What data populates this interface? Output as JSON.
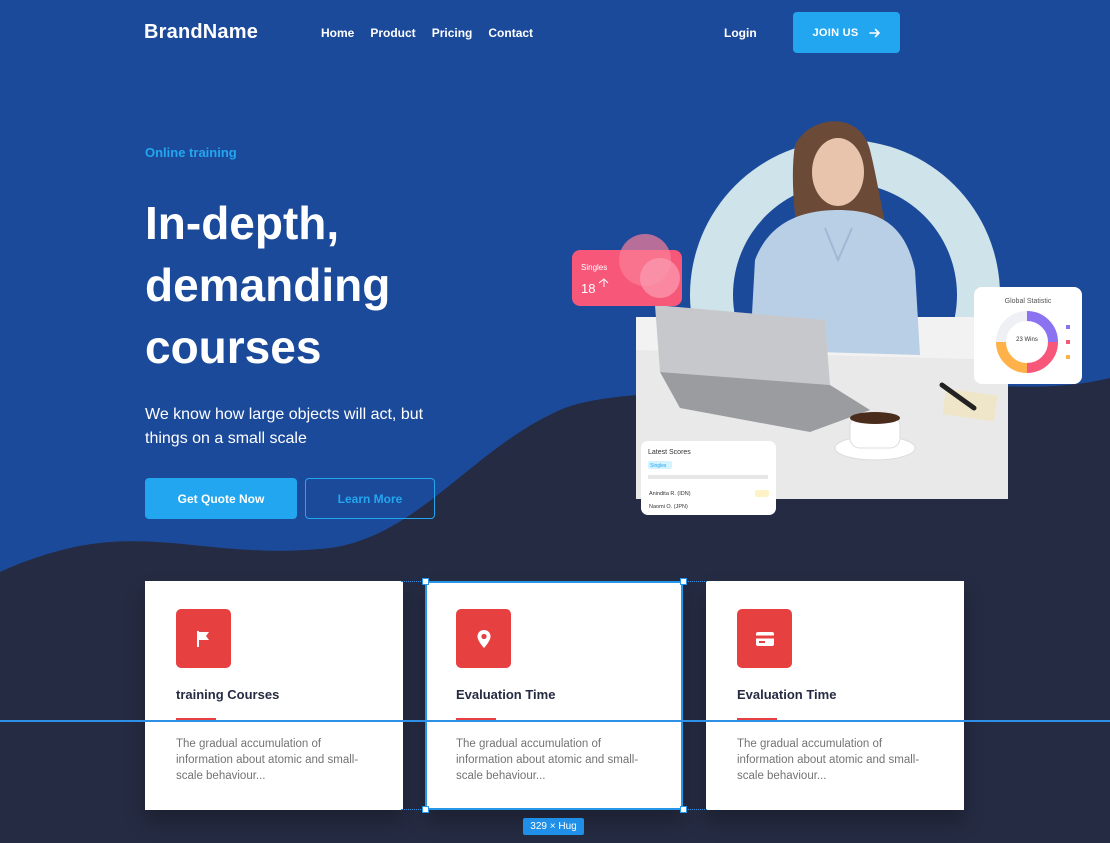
{
  "nav": {
    "brand": "BrandName",
    "links": [
      "Home",
      "Product",
      "Pricing",
      "Contact"
    ],
    "login": "Login",
    "join": "JOIN US"
  },
  "hero": {
    "eyebrow": "Online training",
    "headline": "In-depth, demanding courses",
    "subtitle": "We know how large objects will act, but things on a small scale",
    "primary_cta": "Get Quote Now",
    "secondary_cta": "Learn More"
  },
  "widgets": {
    "singles_label": "Singles",
    "singles_value": "18",
    "stat_title": "Global Statistic",
    "stat_center": "23 Wins",
    "scores_title": "Latest Scores",
    "scores_tag": "Singles",
    "row1": "Anindita R. (IDN)",
    "row2": "Naomi O. (JPN)"
  },
  "cards": [
    {
      "title": "training Courses",
      "desc": "The gradual accumulation of information about atomic and small-scale behaviour...",
      "icon": "flag-icon"
    },
    {
      "title": "Evaluation Time",
      "desc": "The gradual accumulation of information about atomic and small-scale behaviour...",
      "icon": "location-pin-icon"
    },
    {
      "title": "Evaluation Time",
      "desc": "The gradual accumulation of information about atomic and small-scale behaviour...",
      "icon": "credit-card-icon"
    }
  ],
  "design_tool": {
    "size_tag": "329 × Hug"
  },
  "colors": {
    "primary": "#23a6f0",
    "hero_bg": "#1c4a9b",
    "dark_bg": "#252b42",
    "accent_red": "#e74040"
  }
}
